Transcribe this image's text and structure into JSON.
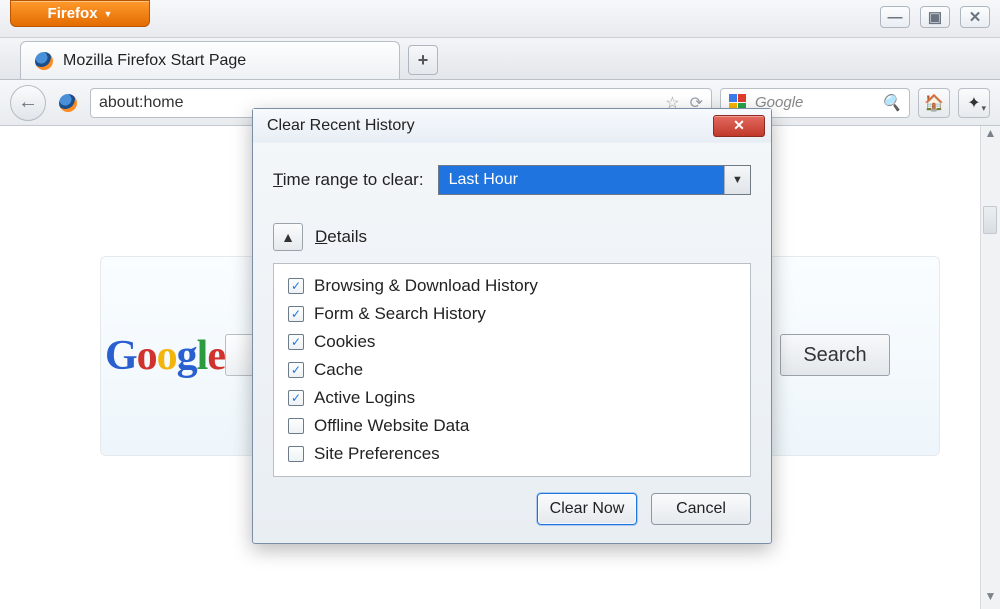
{
  "app_button": {
    "label": "Firefox"
  },
  "window_controls": {
    "min": "—",
    "max": "▣",
    "close": "✕"
  },
  "tab": {
    "title": "Mozilla Firefox Start Page"
  },
  "newtab": "+",
  "urlbar": {
    "value": "about:home"
  },
  "searchbox": {
    "placeholder": "Google",
    "engine": "Google"
  },
  "main": {
    "logo_letters": [
      "G",
      "o",
      "o",
      "g",
      "l",
      "e"
    ],
    "search_button": "Search"
  },
  "dialog": {
    "title": "Clear Recent History",
    "time_label_pre": "T",
    "time_label_rest": "ime range to clear:",
    "time_value": "Last Hour",
    "details_pre": "D",
    "details_rest": "etails",
    "items": [
      {
        "label": "Browsing & Download History",
        "checked": true
      },
      {
        "label": "Form & Search History",
        "checked": true
      },
      {
        "label": "Cookies",
        "checked": true
      },
      {
        "label": "Cache",
        "checked": true
      },
      {
        "label": "Active Logins",
        "checked": true
      },
      {
        "label": "Offline Website Data",
        "checked": false
      },
      {
        "label": "Site Preferences",
        "checked": false
      }
    ],
    "clear_btn": "Clear Now",
    "cancel_btn": "Cancel"
  }
}
